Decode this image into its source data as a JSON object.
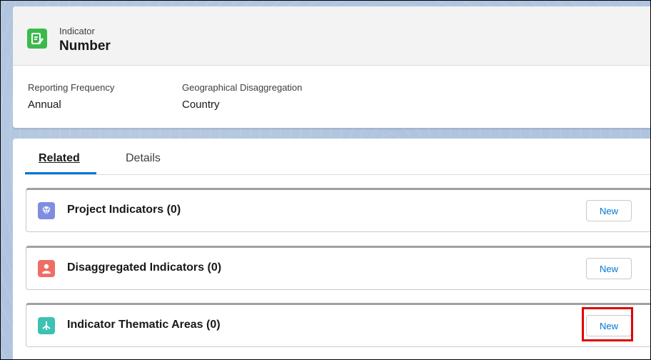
{
  "highlights": {
    "object_type": "Indicator",
    "record_name": "Number",
    "fields": [
      {
        "label": "Reporting Frequency",
        "value": "Annual"
      },
      {
        "label": "Geographical Disaggregation",
        "value": "Country"
      }
    ]
  },
  "tabs": [
    {
      "label": "Related",
      "active": true
    },
    {
      "label": "Details",
      "active": false
    }
  ],
  "related_lists": [
    {
      "title": "Project Indicators (0)",
      "icon": "gem-icon",
      "icon_color": "#7f8de1",
      "button_label": "New"
    },
    {
      "title": "Disaggregated Indicators (0)",
      "icon": "person-icon",
      "icon_color": "#ef6e64",
      "button_label": "New"
    },
    {
      "title": "Indicator Thematic Areas (0)",
      "icon": "hierarchy-icon",
      "icon_color": "#3cc2b3",
      "button_label": "New"
    }
  ],
  "colors": {
    "accent": "#0176d3",
    "object_icon": "#3bba4c",
    "annotation_box": "#e00000"
  }
}
